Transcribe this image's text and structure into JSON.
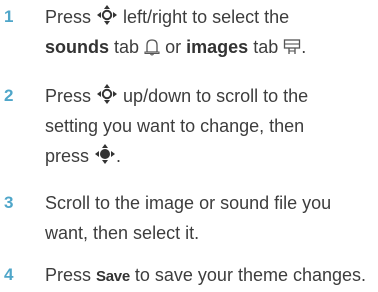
{
  "steps": [
    {
      "number": "1",
      "parts": {
        "a": "Press",
        "b": "left/right to select the",
        "c": "sounds",
        "d": "tab",
        "e": "or",
        "f": "images",
        "g": "tab",
        "h": "."
      }
    },
    {
      "number": "2",
      "parts": {
        "a": "Press",
        "b": "up/down to scroll to the",
        "c": "setting you want to change, then",
        "d": "press",
        "e": "."
      }
    },
    {
      "number": "3",
      "parts": {
        "a": "Scroll to the image or sound file you",
        "b": "want, then select it."
      }
    },
    {
      "number": "4",
      "parts": {
        "a": "Press",
        "b": "Save",
        "c": "to save your theme changes."
      }
    }
  ],
  "icons": {
    "nav_key": "nav-key-icon",
    "nav_key_center": "nav-key-center-icon",
    "sounds_tab": "sounds-tab-icon",
    "images_tab": "images-tab-icon"
  },
  "colors": {
    "step_number": "#4fa6c9",
    "text": "#3d3d3d"
  }
}
